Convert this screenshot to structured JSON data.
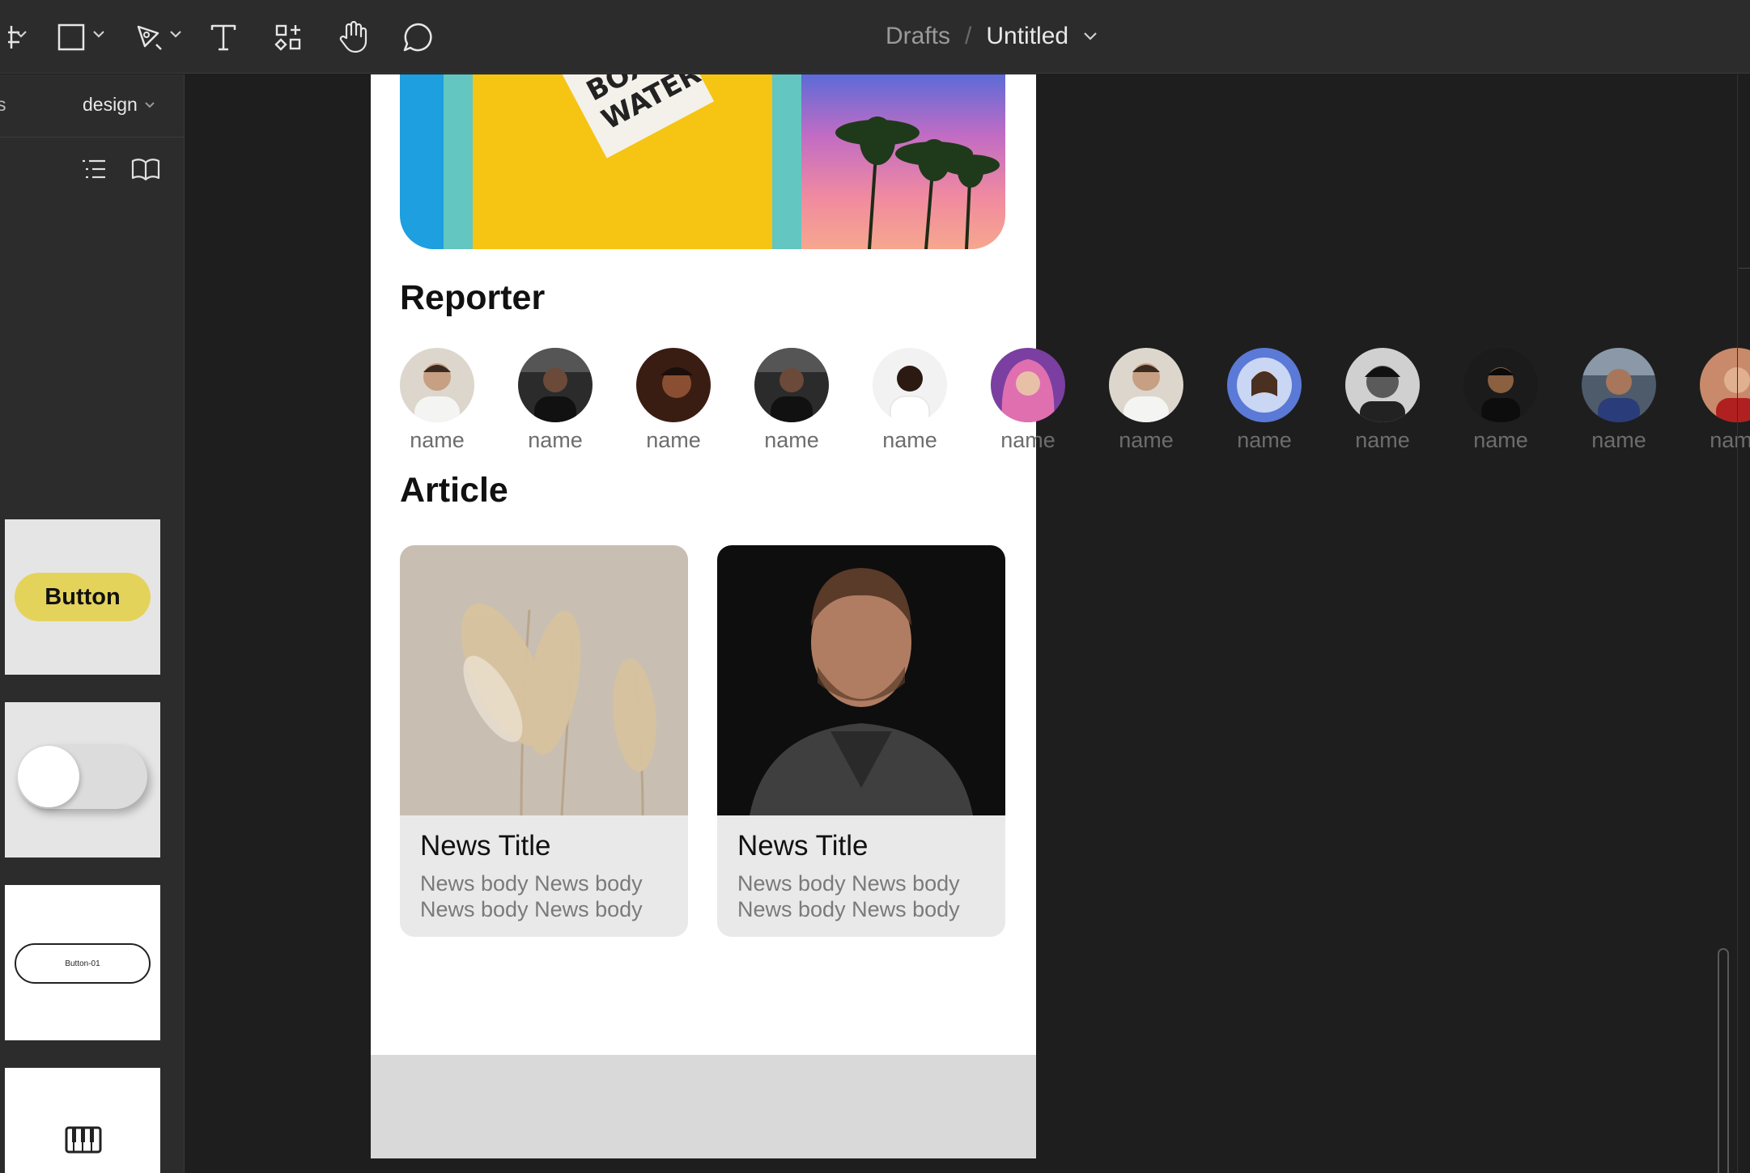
{
  "toolbar": {
    "breadcrumb_root": "Drafts",
    "breadcrumb_sep": "/",
    "file_name": "Untitled"
  },
  "sidebar": {
    "active_tab": "design",
    "partial_tab": "s",
    "assets": [
      {
        "label": "Button"
      },
      {
        "label": "toggle"
      },
      {
        "label": "Button-01"
      },
      {
        "label": "piano"
      }
    ]
  },
  "frame": {
    "reporter_heading": "Reporter",
    "article_heading": "Article",
    "reporters": [
      {
        "name": "name",
        "bg": "#d9d4cc"
      },
      {
        "name": "name",
        "bg": "#2b2b2b"
      },
      {
        "name": "name",
        "bg": "#3a1d12"
      },
      {
        "name": "name",
        "bg": "#2b2b2b"
      },
      {
        "name": "name",
        "bg": "#f2f2f2"
      },
      {
        "name": "name",
        "bg": "#7a3fa0"
      },
      {
        "name": "name",
        "bg": "#d9d4cc"
      },
      {
        "name": "name",
        "bg": "#5b79d6"
      },
      {
        "name": "name",
        "bg": "#cfcfcf"
      },
      {
        "name": "name",
        "bg": "#1b1b1b"
      },
      {
        "name": "name",
        "bg": "#4e5b6a"
      },
      {
        "name": "name",
        "bg": "#c88a6a"
      }
    ],
    "articles": [
      {
        "title": "News Title",
        "body": "News body News body News body News body"
      },
      {
        "title": "News Title",
        "body": "News body News body News body News body"
      }
    ]
  },
  "colors": {
    "toolbar_bg": "#2c2c2c",
    "canvas_bg": "#1e1e1e",
    "accent_button": "#e4d35b"
  }
}
